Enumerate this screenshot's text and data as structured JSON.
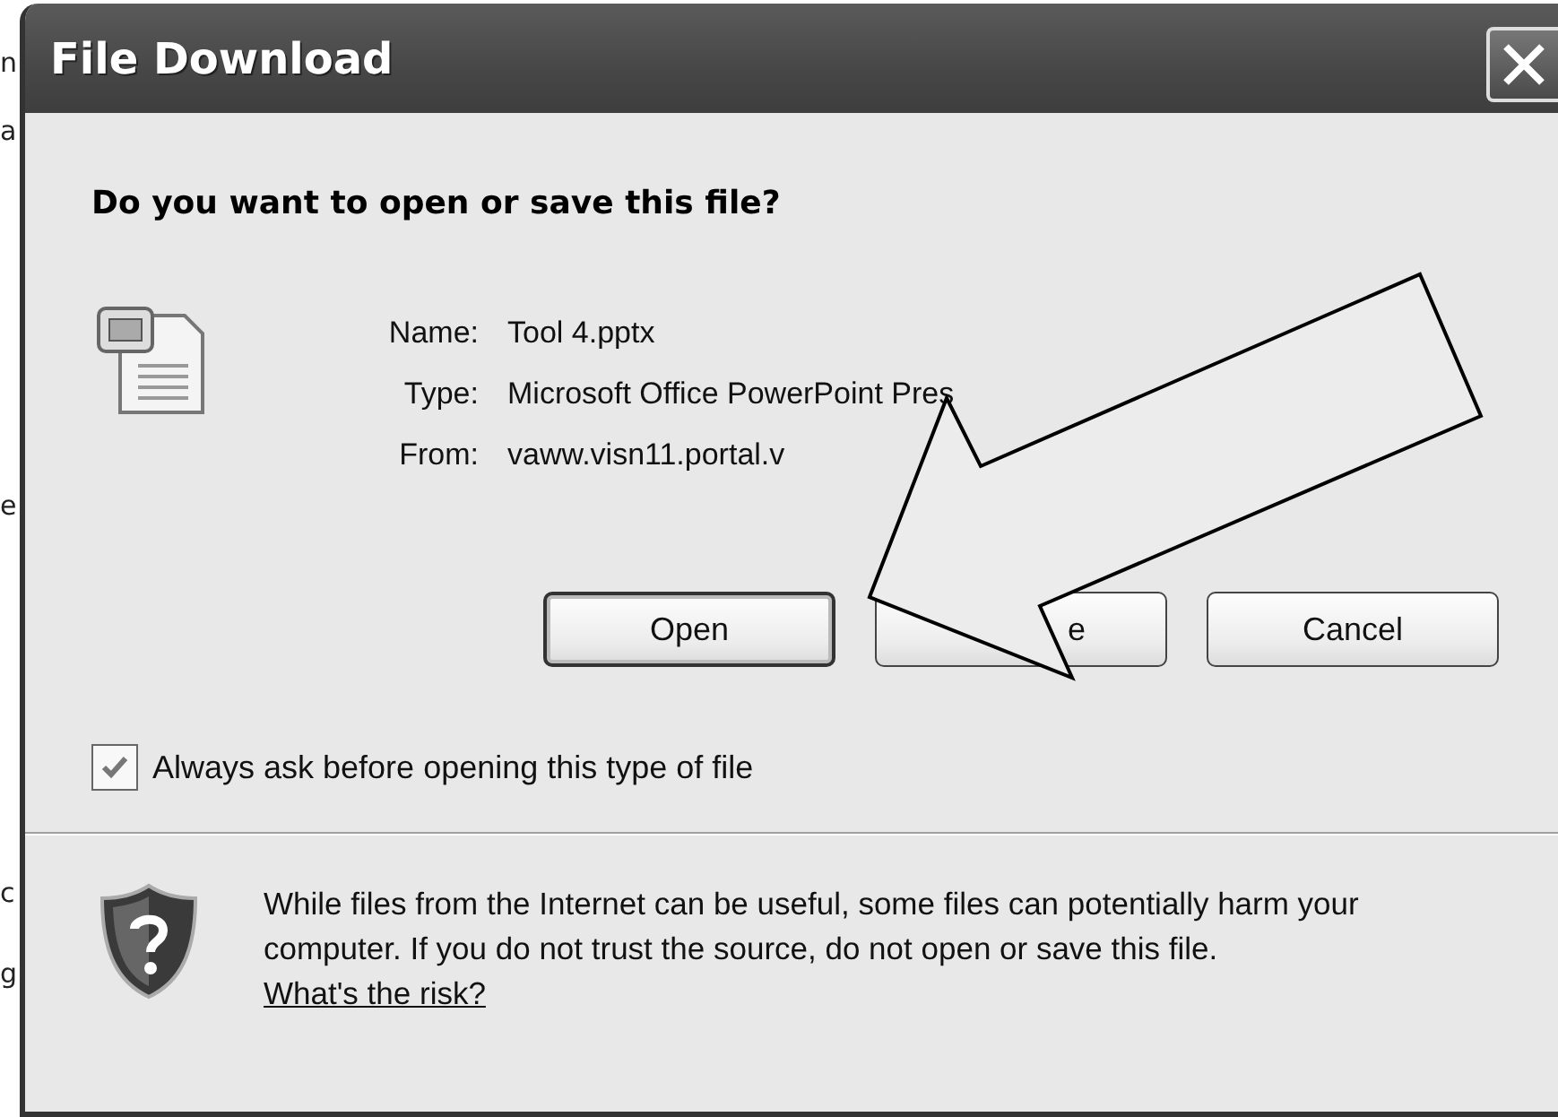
{
  "background_fragments": [
    "n",
    "a",
    "e",
    "c",
    "g"
  ],
  "dialog": {
    "title": "File Download",
    "heading": "Do you want to open or save this file?",
    "fields": [
      {
        "label": "Name:",
        "value": "Tool 4.pptx"
      },
      {
        "label": "Type:",
        "value": "Microsoft Office PowerPoint Pres"
      },
      {
        "label": "From:",
        "value": "vaww.visn11.portal.v"
      }
    ],
    "buttons": [
      {
        "label": "Open",
        "selected": true
      },
      {
        "label": "e",
        "selected": false
      },
      {
        "label": "Cancel",
        "selected": false
      }
    ],
    "always_ask": {
      "label": "Always ask before opening this type of file",
      "checked": true
    },
    "warning": {
      "text": "While files from the Internet can be useful, some files can potentially harm your computer. If you do not trust the source, do not open or save this file.",
      "link": "What's the risk?"
    }
  }
}
